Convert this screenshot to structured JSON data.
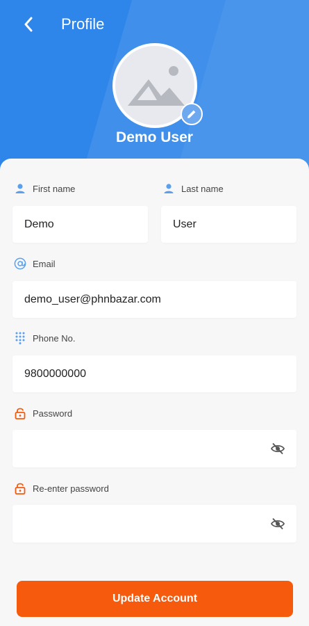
{
  "header": {
    "title": "Profile",
    "user_name": "Demo User",
    "back_icon": "chevron-left-icon",
    "edit_icon": "pencil-icon",
    "avatar_icon": "image-placeholder-icon",
    "bg_color": "#2f86ea"
  },
  "form": {
    "first_name": {
      "label": "First name",
      "value": "Demo",
      "icon": "person-icon"
    },
    "last_name": {
      "label": "Last name",
      "value": "User",
      "icon": "person-icon"
    },
    "email": {
      "label": "Email",
      "value": "demo_user@phnbazar.com",
      "icon": "at-icon"
    },
    "phone": {
      "label": "Phone No.",
      "value": "9800000000",
      "icon": "dialpad-icon"
    },
    "password": {
      "label": "Password",
      "value": "",
      "icon": "lock-icon",
      "toggle_icon": "eye-off-icon"
    },
    "confirm_password": {
      "label": "Re-enter password",
      "value": "",
      "icon": "lock-icon",
      "toggle_icon": "eye-off-icon"
    }
  },
  "submit_label": "Update Account",
  "colors": {
    "accent_blue": "#2f86ea",
    "accent_orange": "#f65a0c"
  }
}
